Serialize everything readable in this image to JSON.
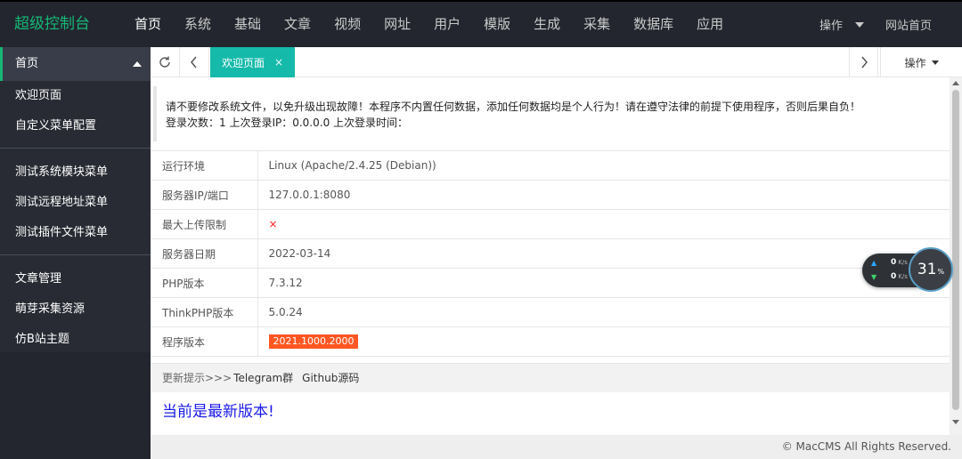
{
  "header": {
    "logo": "超级控制台",
    "nav": [
      "首页",
      "系统",
      "基础",
      "文章",
      "视频",
      "网址",
      "用户",
      "模版",
      "生成",
      "采集",
      "数据库",
      "应用"
    ],
    "operate_label": "操作",
    "site_home_label": "网站首页"
  },
  "sidebar": {
    "head": "首页",
    "group1": [
      "欢迎页面",
      "自定义菜单配置"
    ],
    "group2": [
      "测试系统模块菜单",
      "测试远程地址菜单",
      "测试插件文件菜单"
    ],
    "group3": [
      "文章管理",
      "萌芽采集资源",
      "仿B站主题"
    ]
  },
  "tabs": {
    "active_label": "欢迎页面",
    "close_glyph": "×",
    "operate_label": "操作"
  },
  "notice": {
    "line1": "请不要修改系统文件，以免升级出现故障！本程序不内置任何数据，添加任何数据均是个人行为！请在遵守法律的前提下使用程序，否则后果自负！",
    "line2": "登录次数：1 上次登录IP：0.0.0.0 上次登录时间："
  },
  "info": {
    "rows": [
      {
        "key": "运行环境",
        "value": "Linux (Apache/2.4.25 (Debian))"
      },
      {
        "key": "服务器IP/端口",
        "value": "127.0.0.1:8080"
      },
      {
        "key": "最大上传限制",
        "value": "×"
      },
      {
        "key": "服务器日期",
        "value": "2022-03-14"
      },
      {
        "key": "PHP版本",
        "value": "7.3.12"
      },
      {
        "key": "ThinkPHP版本",
        "value": "5.0.24"
      },
      {
        "key": "程序版本",
        "value": "2021.1000.2000"
      }
    ]
  },
  "update": {
    "prefix": "更新提示>>>",
    "telegram": "Telegram群",
    "github": "Github源码",
    "latest": "当前是最新版本!"
  },
  "footer": {
    "copyright": "© MacCMS All Rights Reserved."
  },
  "speed_widget": {
    "up_value": "0",
    "up_unit": "K/s",
    "down_value": "0",
    "down_unit": "K/s",
    "percent": "31",
    "percent_sign": "%"
  },
  "colors": {
    "accent": "#16baaa",
    "logo": "#16b777",
    "badge": "#ff5722",
    "latest_text": "#1a1ae8"
  }
}
